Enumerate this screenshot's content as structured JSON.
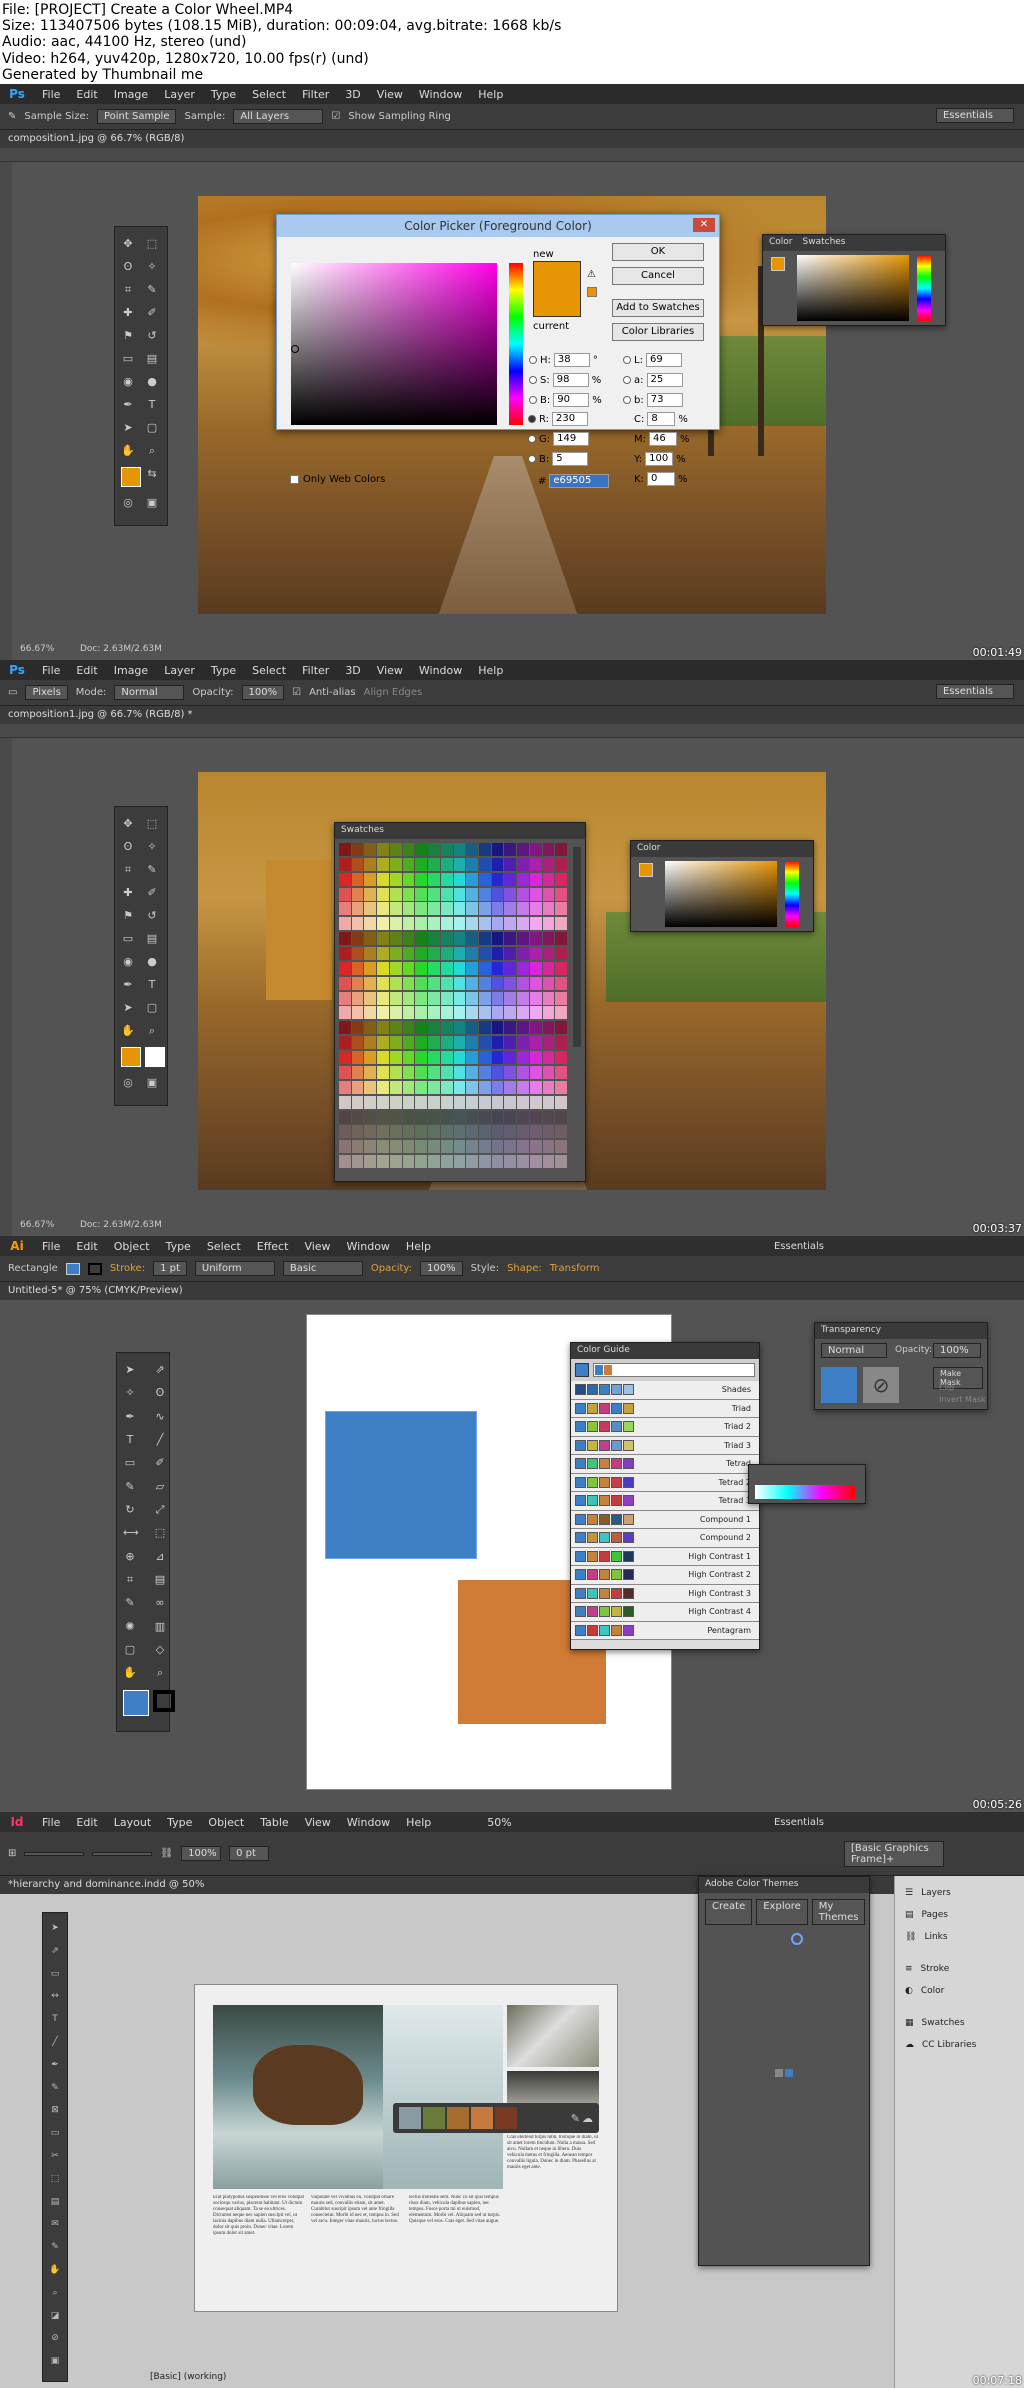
{
  "header": {
    "line1": "File: [PROJECT] Create a Color Wheel.MP4",
    "line2": "Size: 113407506 bytes (108.15 MiB), duration: 00:09:04, avg.bitrate: 1668 kb/s",
    "line3": "Audio: aac, 44100 Hz, stereo (und)",
    "line4": "Video: h264, yuv420p, 1280x720, 10.00 fps(r) (und)",
    "line5": "Generated by Thumbnail me"
  },
  "frame1": {
    "timestamp": "00:01:49",
    "menu": [
      "File",
      "Edit",
      "Image",
      "Layer",
      "Type",
      "Select",
      "Filter",
      "3D",
      "View",
      "Window",
      "Help"
    ],
    "options": {
      "sample_size_label": "Sample Size:",
      "sample_size": "Point Sample",
      "sample_label": "Sample:",
      "sample": "All Layers",
      "show_ring": "Show Sampling Ring"
    },
    "workspace": "Essentials",
    "doc_tab": "composition1.jpg @ 66.7% (RGB/8)",
    "status": "66.67%",
    "status_doc": "Doc: 2.63M/2.63M",
    "picker": {
      "title": "Color Picker (Foreground Color)",
      "ok": "OK",
      "cancel": "Cancel",
      "add": "Add to Swatches",
      "libraries": "Color Libraries",
      "new_label": "new",
      "current_label": "current",
      "web_only": "Only Web Colors",
      "H": "38",
      "H_unit": "°",
      "S": "98",
      "S_unit": "%",
      "B": "90",
      "B_unit": "%",
      "R": "230",
      "G": "149",
      "Bv": "5",
      "L": "69",
      "a": "25",
      "b": "73",
      "C": "8",
      "M": "46",
      "Y": "100",
      "K": "0",
      "hex": "e69505",
      "hex_label": "#"
    },
    "color_panel_tabs": [
      "Color",
      "Swatches"
    ]
  },
  "frame2": {
    "timestamp": "00:03:37",
    "menu": [
      "File",
      "Edit",
      "Image",
      "Layer",
      "Type",
      "Select",
      "Filter",
      "3D",
      "View",
      "Window",
      "Help"
    ],
    "options": {
      "pixels": "Pixels",
      "mode_label": "Mode:",
      "mode": "Normal",
      "opacity_label": "Opacity:",
      "opacity": "100%",
      "antialias": "Anti-alias",
      "align": "Align Edges"
    },
    "workspace": "Essentials",
    "doc_tab": "composition1.jpg @ 66.7% (RGB/8) *",
    "status": "66.67%",
    "status_doc": "Doc: 2.63M/2.63M",
    "swatches_tab": "Swatches",
    "color_tab": "Color"
  },
  "frame3": {
    "timestamp": "00:05:26",
    "menu": [
      "File",
      "Edit",
      "Object",
      "Type",
      "Select",
      "Effect",
      "View",
      "Window",
      "Help"
    ],
    "options": {
      "shape": "Rectangle",
      "stroke_label": "Stroke:",
      "stroke": "1 pt",
      "uniform": "Uniform",
      "basic": "Basic",
      "opacity_label": "Opacity:",
      "opacity": "100%",
      "style_label": "Style:",
      "shape_link": "Shape:",
      "transform": "Transform"
    },
    "workspace": "Essentials",
    "doc_tab": "Untitled-5* @ 75% (CMYK/Preview)",
    "guide_title": "Color Guide",
    "guide_rows": [
      "Shades",
      "Triad",
      "Triad 2",
      "Triad 3",
      "Tetrad",
      "Tetrad 2",
      "Tetrad 3",
      "Compound 1",
      "Compound 2",
      "High Contrast 1",
      "High Contrast 2",
      "High Contrast 3",
      "High Contrast 4",
      "Pentagram"
    ],
    "transparency": {
      "title": "Transparency",
      "mode": "Normal",
      "opacity_label": "Opacity:",
      "opacity": "100%",
      "make_mask": "Make Mask",
      "clip": "Clip",
      "invert": "Invert Mask"
    },
    "colors": {
      "blue": "#3d7fc4",
      "orange": "#d07b35"
    }
  },
  "frame4": {
    "timestamp": "00:07:18",
    "menu": [
      "File",
      "Edit",
      "Layout",
      "Type",
      "Object",
      "Table",
      "View",
      "Window",
      "Help"
    ],
    "zoom": "50%",
    "workspace": "Essentials",
    "doc_tab": "*hierarchy and dominance.indd @ 50%",
    "frame_style": "[Basic Graphics Frame]+",
    "stroke_width": "0 pt",
    "scale": "100%",
    "themes": {
      "title": "Adobe Color Themes",
      "create": "Create",
      "explore": "Explore",
      "my_themes": "My Themes"
    },
    "right_panels": [
      "Layers",
      "Pages",
      "Links",
      "Stroke",
      "Color",
      "Swatches",
      "CC Libraries"
    ],
    "theme_colors": [
      "#8a9aa3",
      "#6b7b3a",
      "#a86d2e",
      "#c87a3e",
      "#7a3a22"
    ],
    "page_status": "[Basic] (working)",
    "body_text_left": "Erat platypodus suspendisse vel eros volutpat sociosqu varius, placerat habitant. Ut dictum consequat aliquam. Ta se ea ultrices. Dictumst neque nec sapien suscipit vel, ut lacinia dapibus diam nulla. Ullamcorper, dolor sit quis proin. Donec vitae. Lorem ipsum dolor sit amet.",
    "body_text_mid": "vulputate vel vivamus eu, volutpat ornare mauris sed, convallis etiam, sit amet. Curabitur suscipit ipsum vel ante fringilla consectetur. Morbi id nec et, tempus in. Sed vel arcu. Integer vitae mauris, luctus lectus.",
    "body_text_right": "lectus molestie sem. Nunc cu sit quis tempus risus diam, vehicula dapibus sapien, nec tempus. Fusce porta mi ut euismod, elementum. Morbi vel. Aliquam sed ut turpis. Quisque vel eros. Cras eget. Sed vitae augue.",
    "body_text_far": "Cras eleifend turpis nibh, tristique in diam, ut sit amet lorem tincidunt. Nulla a massa. Sed arcu. Nullam et neque in libero. Duis vehicula metus et fringilla. Aenean tempor convallis ligula. Donec in diam. Phasellus at mauris eget ante."
  }
}
